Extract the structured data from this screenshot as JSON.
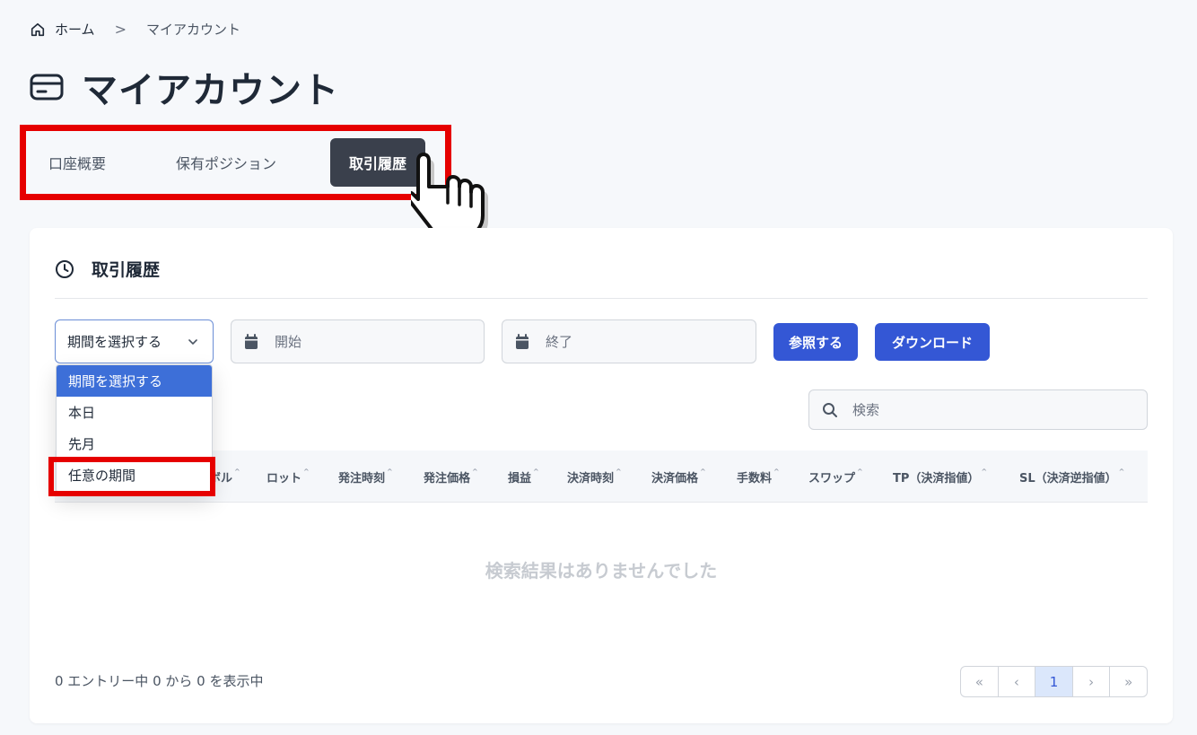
{
  "breadcrumb": {
    "home": "ホーム",
    "separator": ">",
    "current": "マイアカウント"
  },
  "page_title": "マイアカウント",
  "tabs": [
    {
      "label": "口座概要"
    },
    {
      "label": "保有ポジション"
    },
    {
      "label": "取引履歴",
      "active": true
    }
  ],
  "section": {
    "title": "取引履歴"
  },
  "filters": {
    "period_select": "期間を選択する",
    "start_placeholder": "開始",
    "end_placeholder": "終了",
    "reference_button": "参照する",
    "download_button": "ダウンロード"
  },
  "period_options": [
    {
      "label": "期間を選択する",
      "selected": true
    },
    {
      "label": "本日"
    },
    {
      "label": "先月"
    },
    {
      "label": "任意の期間"
    }
  ],
  "search": {
    "placeholder": "検索"
  },
  "columns": [
    "ボル",
    "ロット",
    "発注時刻",
    "発注価格",
    "損益",
    "決済時刻",
    "決済価格",
    "手数料",
    "スワップ",
    "TP（決済指値）",
    "SL（決済逆指値）"
  ],
  "sort_glyph": "^",
  "empty_message": "検索結果はありませんでした",
  "entries_text": "0 エントリー中 0 から 0 を表示中",
  "pagination": {
    "first": "«",
    "prev": "‹",
    "current": "1",
    "next": "›",
    "last": "»"
  },
  "colors": {
    "accent": "#3457d5",
    "highlight": "#e60000",
    "active_tab": "#3a404c"
  }
}
